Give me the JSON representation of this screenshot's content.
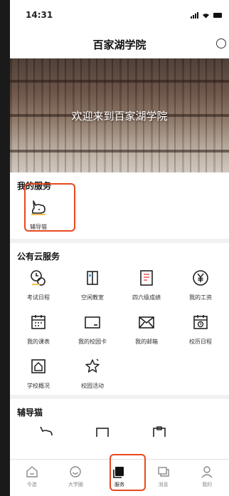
{
  "status_bar": {
    "time": "14:31"
  },
  "header": {
    "title": "百家湖学院",
    "search_icon": "search-icon"
  },
  "banner": {
    "text": "欢迎来到百家湖学院"
  },
  "my_services": {
    "title": "我的服务",
    "items": [
      {
        "label": "辅导猫",
        "icon": "cat-icon"
      }
    ]
  },
  "public_services": {
    "title": "公有云服务",
    "items": [
      {
        "label": "考试日程",
        "icon": "exam-schedule-icon"
      },
      {
        "label": "空闲教室",
        "icon": "classroom-icon"
      },
      {
        "label": "四六级成绩",
        "icon": "cet-score-icon"
      },
      {
        "label": "我的工资",
        "icon": "salary-icon"
      },
      {
        "label": "我的课表",
        "icon": "timetable-icon"
      },
      {
        "label": "我的校园卡",
        "icon": "campus-card-icon"
      },
      {
        "label": "我的邮箱",
        "icon": "mail-icon"
      },
      {
        "label": "校历日程",
        "icon": "school-calendar-icon"
      },
      {
        "label": "学校概况",
        "icon": "school-overview-icon"
      },
      {
        "label": "校园活动",
        "icon": "campus-activity-icon"
      }
    ]
  },
  "tutor_cat_section": {
    "title": "辅导猫"
  },
  "tabbar": {
    "items": [
      {
        "label": "今选",
        "icon": "home-icon",
        "active": false
      },
      {
        "label": "大学圈",
        "icon": "circle-icon",
        "active": false
      },
      {
        "label": "服务",
        "icon": "service-icon",
        "active": true
      },
      {
        "label": "消息",
        "icon": "message-icon",
        "active": false
      },
      {
        "label": "我的",
        "icon": "profile-icon",
        "active": false
      }
    ]
  },
  "colors": {
    "highlight": "#e8491d",
    "text": "#222222"
  }
}
